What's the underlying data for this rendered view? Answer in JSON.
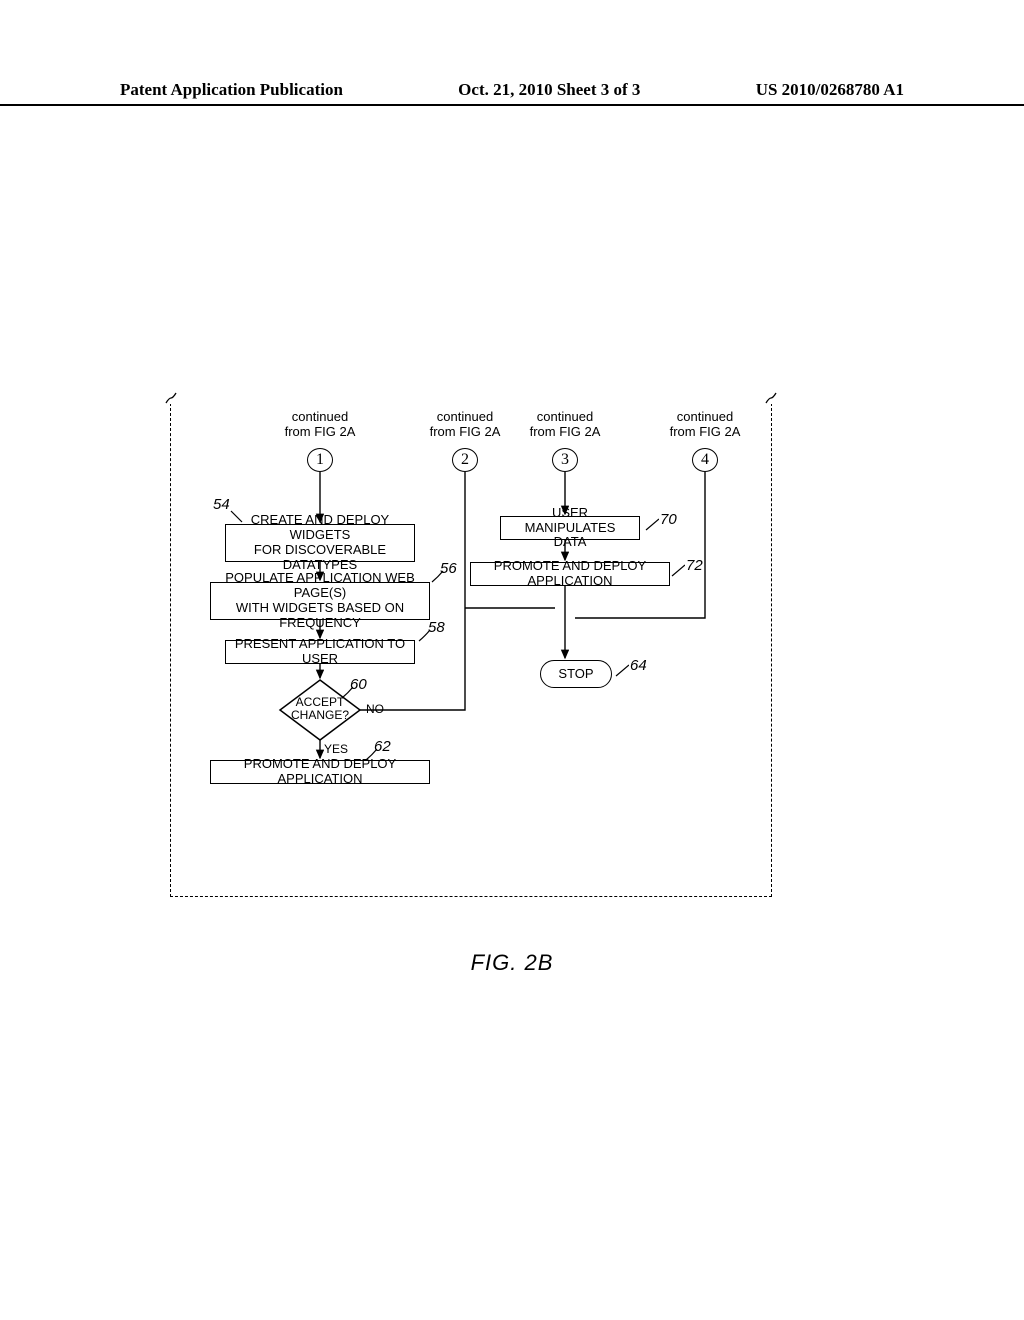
{
  "header": {
    "left": "Patent Application Publication",
    "mid": "Oct. 21, 2010  Sheet 3 of 3",
    "right": "US 2010/0268780 A1"
  },
  "continued_label": "continued\nfrom FIG 2A",
  "connectors": {
    "c1": "1",
    "c2": "2",
    "c3": "3",
    "c4": "4"
  },
  "left_flow": {
    "b54": "CREATE AND DEPLOY WIDGETS\nFOR DISCOVERABLE DATATYPES",
    "b56": "POPULATE APPLICATION WEB PAGE(S)\nWITH WIDGETS BASED ON FREQUENCY",
    "b58": "PRESENT APPLICATION TO USER",
    "d60": "ACCEPT\nCHANGE?",
    "d60_no": "NO",
    "d60_yes": "YES",
    "b62": "PROMOTE AND DEPLOY APPLICATION"
  },
  "right_flow": {
    "b70": "USER MANIPULATES DATA",
    "b72": "PROMOTE AND DEPLOY APPLICATION"
  },
  "stop": "STOP",
  "refs": {
    "r54": "54",
    "r56": "56",
    "r58": "58",
    "r60": "60",
    "r62": "62",
    "r64": "64",
    "r70": "70",
    "r72": "72"
  },
  "figure_caption": "FIG. 2B"
}
